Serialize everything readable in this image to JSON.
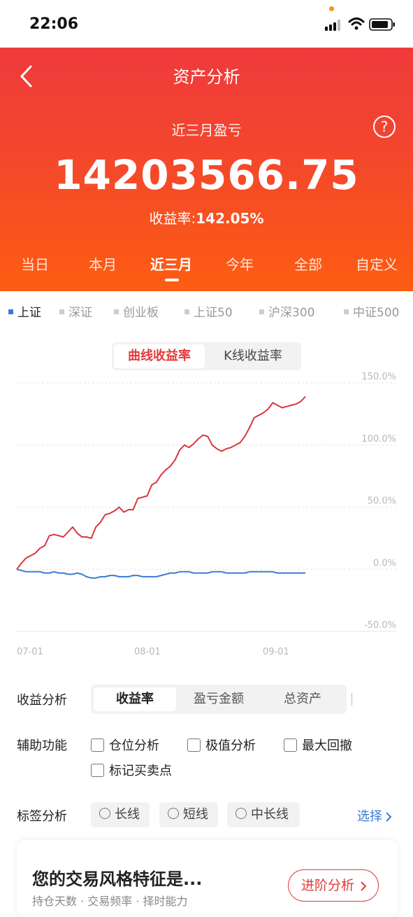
{
  "status_bar": {
    "time": "22:06"
  },
  "header": {
    "title": "资产分析",
    "period_label": "近三月盈亏",
    "help_symbol": "?",
    "amount": "14203566.75",
    "rate_label": "收益率:",
    "rate_value": "142.05%",
    "tabs": [
      "当日",
      "本月",
      "近三月",
      "今年",
      "全部",
      "自定义"
    ],
    "active_tab": "近三月"
  },
  "index_tabs": [
    "上证",
    "深证",
    "创业板",
    "上证50",
    "沪深300",
    "中证500"
  ],
  "active_index": "上证",
  "chart_toggle": {
    "curve": "曲线收益率",
    "kline": "K线收益率",
    "active": "曲线收益率"
  },
  "chart_data": {
    "type": "line",
    "x_tick_labels": [
      "07-01",
      "08-01",
      "09-01"
    ],
    "y_tick_labels": [
      "150.0%",
      "100.0%",
      "50.0%",
      "0.0%",
      "-50.0%"
    ],
    "ylim": [
      -50,
      150
    ],
    "grid": true,
    "series": [
      {
        "color": "#d9363e",
        "values": [
          0,
          5,
          9,
          11,
          13,
          17,
          19,
          27,
          28,
          27,
          26,
          30,
          34,
          29,
          26,
          26,
          25,
          34,
          38,
          44,
          45,
          47,
          50,
          46,
          48,
          48,
          57,
          58,
          59,
          68,
          70,
          76,
          80,
          83,
          88,
          96,
          100,
          98,
          101,
          105,
          108,
          107,
          100,
          97,
          95,
          97,
          98,
          100,
          102,
          107,
          114,
          122,
          124,
          126,
          129,
          134,
          132,
          130,
          131,
          132,
          133,
          135,
          139
        ]
      },
      {
        "color": "#3a7bd5",
        "values": [
          0,
          -1,
          -2,
          -2,
          -2,
          -2,
          -3,
          -3,
          -2,
          -3,
          -3,
          -4,
          -4,
          -3,
          -4,
          -6,
          -7,
          -7,
          -6,
          -6,
          -5,
          -5,
          -6,
          -6,
          -6,
          -5,
          -5,
          -6,
          -6,
          -6,
          -6,
          -5,
          -4,
          -3,
          -3,
          -2,
          -2,
          -2,
          -3,
          -3,
          -3,
          -3,
          -2,
          -2,
          -2,
          -3,
          -3,
          -3,
          -3,
          -3,
          -2,
          -2,
          -2,
          -2,
          -2,
          -2,
          -3,
          -3,
          -3,
          -3,
          -3,
          -3,
          -3
        ]
      }
    ]
  },
  "analysis": {
    "label": "收益分析",
    "options": [
      "收益率",
      "盈亏金额",
      "总资产"
    ],
    "active": "收益率"
  },
  "aux": {
    "label": "辅助功能",
    "checks": [
      "仓位分析",
      "极值分析",
      "最大回撤",
      "标记买卖点"
    ]
  },
  "tags": {
    "label": "标签分析",
    "options": [
      "长线",
      "短线",
      "中长线"
    ],
    "select_link": "选择"
  },
  "style_card": {
    "title": "您的交易风格特征是...",
    "button": "进阶分析",
    "subtitle": "持仓天数 · 交易频率 · 择时能力"
  }
}
